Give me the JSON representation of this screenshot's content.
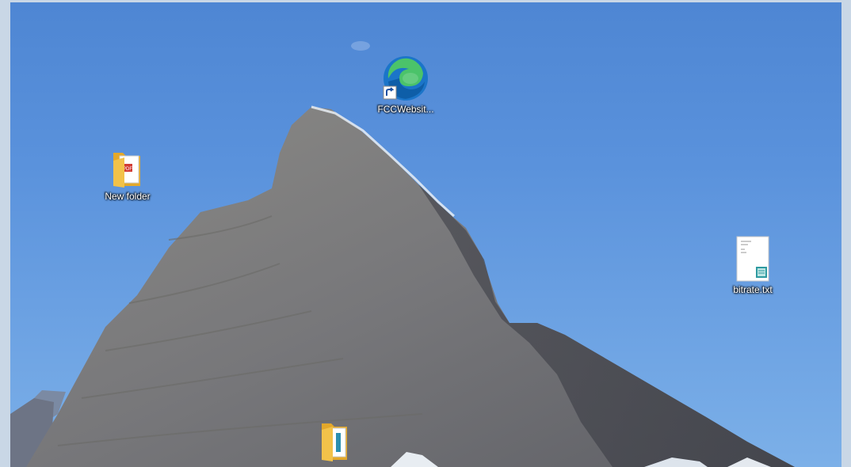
{
  "desktop": {
    "icons": [
      {
        "label": "FCCWebsit...",
        "icon": "edge-shortcut-icon"
      },
      {
        "label": "New folder",
        "icon": "folder-pdf-icon"
      },
      {
        "label": "bitrate.txt",
        "icon": "text-file-icon"
      },
      {
        "label": "",
        "icon": "folder-icon"
      }
    ]
  },
  "colors": {
    "sky": "#5a92dc",
    "rock": "#7d7d7b",
    "folder": "#f2c24a",
    "edge_blue": "#1b75c9",
    "edge_green": "#4bc36a"
  }
}
